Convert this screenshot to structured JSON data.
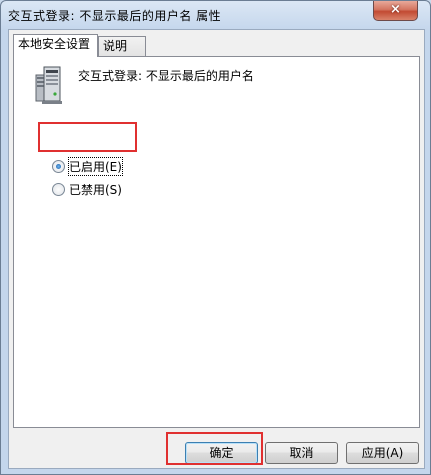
{
  "window": {
    "title": "交互式登录: 不显示最后的用户名 属性",
    "close_glyph": "×"
  },
  "tabs": [
    {
      "label": "本地安全设置",
      "active": true
    },
    {
      "label": "说明",
      "active": false
    }
  ],
  "policy": {
    "icon": "server-policy-icon",
    "name": "交互式登录: 不显示最后的用户名"
  },
  "options": [
    {
      "label": "已启用(E)",
      "checked": true
    },
    {
      "label": "已禁用(S)",
      "checked": false
    }
  ],
  "buttons": {
    "ok": "确定",
    "cancel": "取消",
    "apply": "应用(A)"
  },
  "colors": {
    "highlight": "#e03030",
    "radio_selected": "#1a5ea8"
  }
}
